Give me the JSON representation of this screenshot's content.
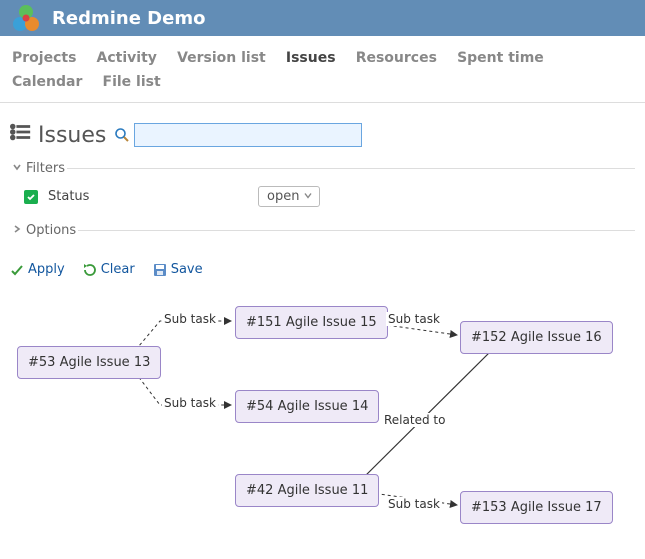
{
  "app": {
    "title": "Redmine Demo"
  },
  "nav": {
    "items": [
      {
        "label": "Projects"
      },
      {
        "label": "Activity"
      },
      {
        "label": "Version list"
      },
      {
        "label": "Issues"
      },
      {
        "label": "Resources"
      },
      {
        "label": "Spent time"
      },
      {
        "label": "Calendar"
      },
      {
        "label": "File list"
      }
    ],
    "active": "Issues"
  },
  "page": {
    "title": "Issues"
  },
  "search": {
    "placeholder": ""
  },
  "filters": {
    "legend": "Filters",
    "status": {
      "label": "Status",
      "checked": true,
      "value": "open"
    }
  },
  "options": {
    "legend": "Options"
  },
  "actions": {
    "apply": "Apply",
    "clear": "Clear",
    "save": "Save"
  },
  "diagram": {
    "nodes": {
      "n53": {
        "label": "#53 Agile Issue 13"
      },
      "n151": {
        "label": "#151 Agile Issue 15"
      },
      "n54": {
        "label": "#54 Agile Issue 14"
      },
      "n152": {
        "label": "#152 Agile Issue 16"
      },
      "n42": {
        "label": "#42 Agile Issue 11"
      },
      "n153": {
        "label": "#153 Agile Issue 17"
      }
    },
    "edges": {
      "e1": {
        "label": "Sub task"
      },
      "e2": {
        "label": "Sub task"
      },
      "e3": {
        "label": "Sub task"
      },
      "e4": {
        "label": "Related to"
      },
      "e5": {
        "label": "Sub task"
      }
    }
  }
}
